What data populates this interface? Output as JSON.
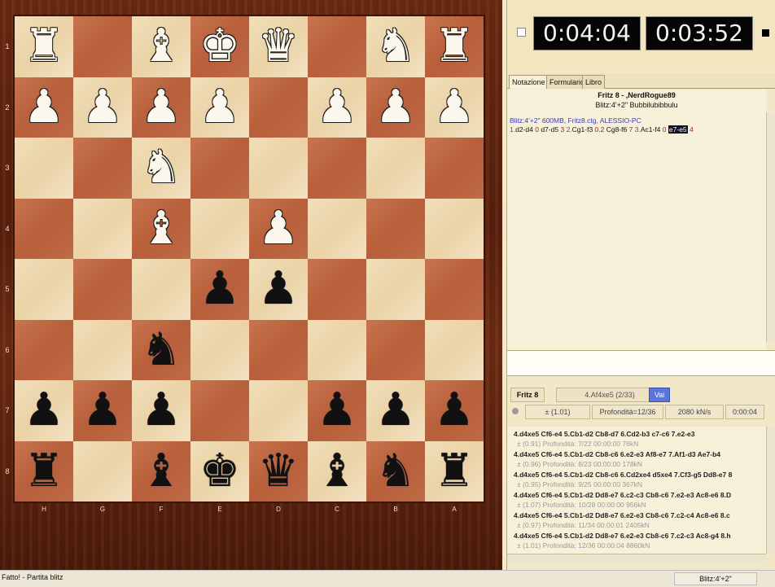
{
  "board": {
    "rank_labels": [
      "1",
      "2",
      "3",
      "4",
      "5",
      "6",
      "7",
      "8"
    ],
    "file_labels": [
      "H",
      "G",
      "F",
      "E",
      "D",
      "C",
      "B",
      "A"
    ],
    "rows": [
      [
        "wR",
        "",
        "wB",
        "wK",
        "wQ",
        "",
        "wN",
        "wR"
      ],
      [
        "wP",
        "wP",
        "wP",
        "wP",
        "",
        "wP",
        "wP",
        "wP"
      ],
      [
        "",
        "",
        "wN",
        "",
        "",
        "",
        "",
        ""
      ],
      [
        "",
        "",
        "wB",
        "",
        "wP",
        "",
        "",
        ""
      ],
      [
        "",
        "",
        "",
        "bP",
        "bP",
        "",
        "",
        ""
      ],
      [
        "",
        "",
        "bN",
        "",
        "",
        "",
        "",
        ""
      ],
      [
        "bP",
        "bP",
        "bP",
        "",
        "",
        "bP",
        "bP",
        "bP"
      ],
      [
        "bR",
        "",
        "bB",
        "bK",
        "bQ",
        "bB",
        "bN",
        "bR"
      ]
    ],
    "colors": {
      "light": "#f1dfba",
      "dark": "#b75e3b",
      "frame": "#5a200c"
    }
  },
  "clocks": {
    "left": "0:04:04",
    "right": "0:03:52"
  },
  "tabs": [
    "Notazione",
    "Formulario",
    "Libro"
  ],
  "notation": {
    "players": "Fritz 8 - ,NerdRogue89",
    "event": "Blitz:4'+2\" Bubbilubibbulu",
    "meta": "Blitz:4'+2\"  600MB, Fritz8.ctg, ALESSIO-PC",
    "moves": [
      {
        "num": "1.",
        "san": "d2-d4",
        "time": "0"
      },
      {
        "san": "d7-d5",
        "time": "3"
      },
      {
        "num": "2.",
        "san": "Cg1-f3",
        "time": "0.2"
      },
      {
        "san": "Cg8-f6",
        "time": "7"
      },
      {
        "num": "3.",
        "san": "Ac1-f4",
        "time": "0"
      },
      {
        "san": "e7-e5",
        "time": "4",
        "selected": true
      }
    ]
  },
  "engine": {
    "name": "Fritz 8",
    "current_move": "4.Af4xe5 (2/33)",
    "go_label": "Vai",
    "eval": "± (1.01)",
    "depth": "Profondità=12/36",
    "speed": "2080 kN/s",
    "time": "0:00:04",
    "lines": [
      {
        "line": "4.d4xe5 Cf6-e4 5.Cb1-d2 Cb8-d7 6.Cd2-b3 c7-c6 7.e2-e3",
        "stat": "± (0.91)  Profondità: 7/22  00:00:00  76kN"
      },
      {
        "line": "4.d4xe5 Cf6-e4 5.Cb1-d2 Cb8-c6 6.e2-e3 Af8-e7 7.Af1-d3 Ae7-b4",
        "stat": "± (0.96)  Profondità: 8/23  00:00:00  178kN"
      },
      {
        "line": "4.d4xe5 Cf6-e4 5.Cb1-d2 Cb8-c6 6.Cd2xe4 d5xe4 7.Cf3-g5 Dd8-e7 8",
        "stat": "± (0.95)  Profondità: 9/25  00:00:00  367kN"
      },
      {
        "line": "4.d4xe5 Cf6-e4 5.Cb1-d2 Dd8-e7 6.c2-c3 Cb8-c6 7.e2-e3 Ac8-e6 8.D",
        "stat": "± (1.07)  Profondità: 10/28  00:00:00  956kN"
      },
      {
        "line": "4.d4xe5 Cf6-e4 5.Cb1-d2 Dd8-e7 6.e2-e3 Cb8-c6 7.c2-c4 Ac8-e6 8.c",
        "stat": "± (0.97)  Profondità: 11/34  00:00:01  2405kN"
      },
      {
        "line": "4.d4xe5 Cf6-e4 5.Cb1-d2 Dd8-e7 6.e2-e3 Cb8-c6 7.c2-c3 Ac8-g4 8.h",
        "stat": "± (1.01)  Profondità: 12/36  00:00:04  8860kN"
      }
    ]
  },
  "statusbar": {
    "left": "Fatto! - Partita blitz",
    "right": "Blitz:4'+2\""
  }
}
